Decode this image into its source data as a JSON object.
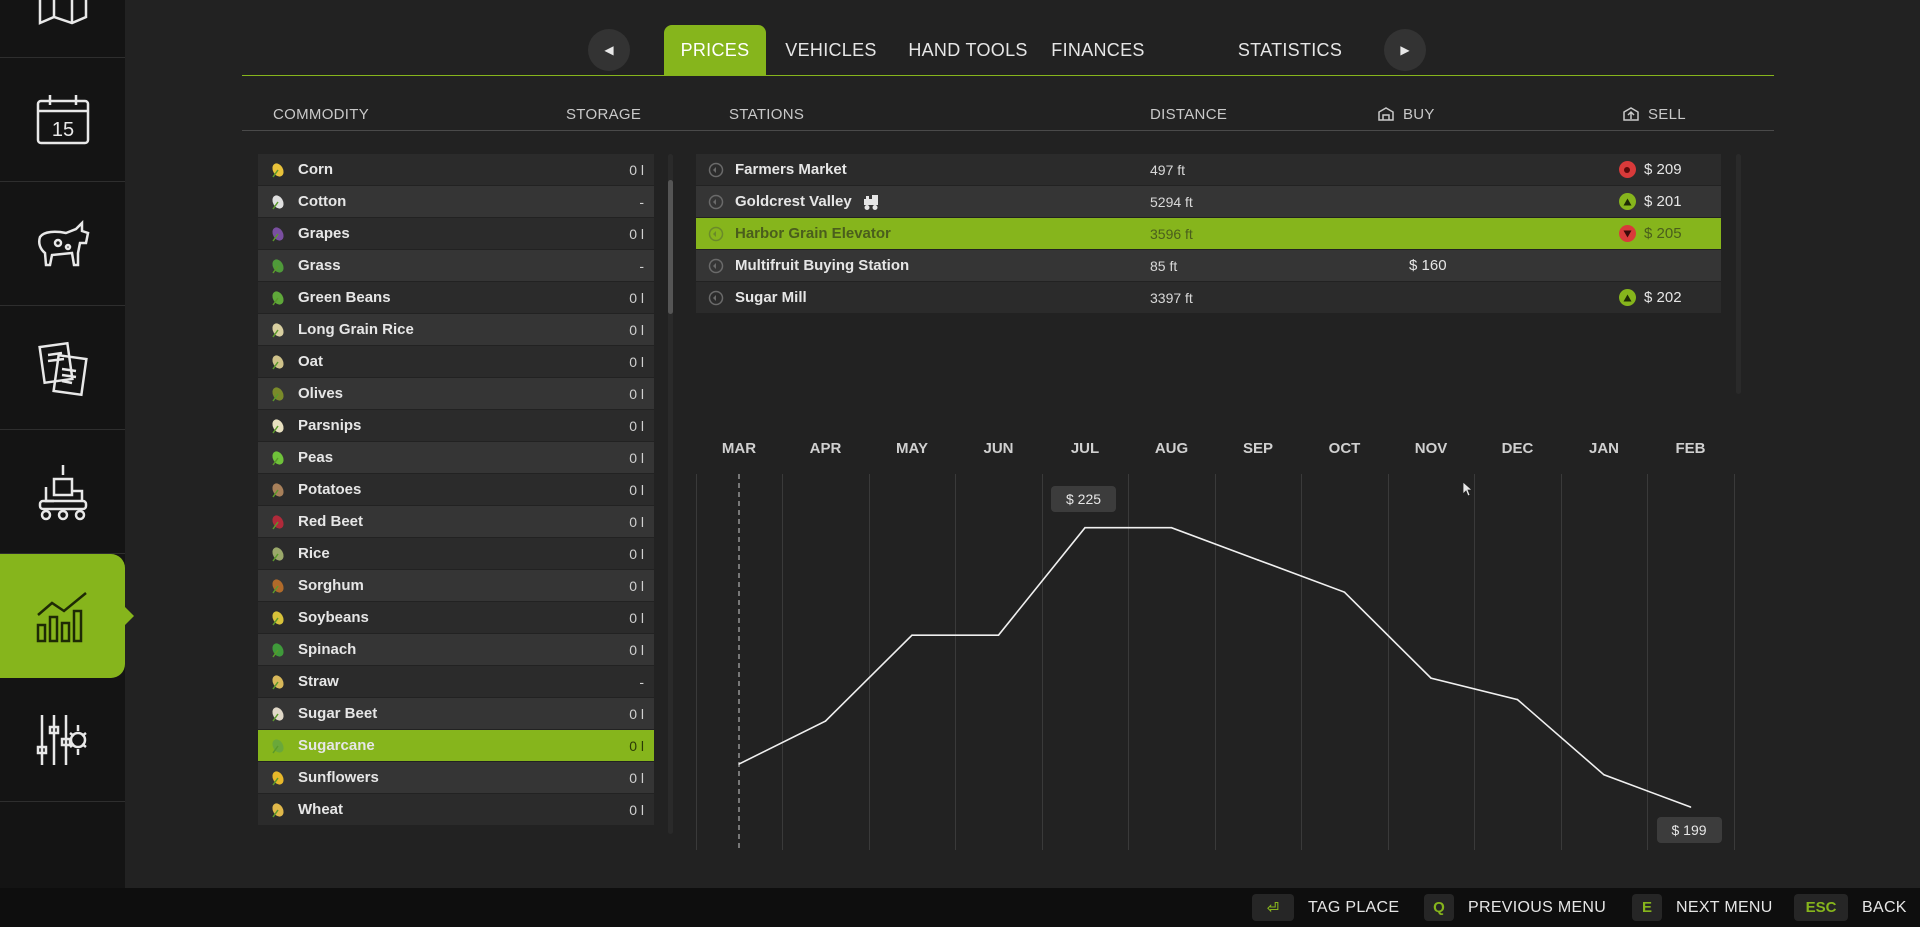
{
  "sidebar": {
    "items": [
      {
        "name": "map-icon",
        "active": false
      },
      {
        "name": "calendar-icon",
        "label": "15",
        "active": false
      },
      {
        "name": "cow-icon",
        "active": false
      },
      {
        "name": "contracts-icon",
        "active": false
      },
      {
        "name": "production-icon",
        "active": false
      },
      {
        "name": "prices-chart-icon",
        "active": true
      },
      {
        "name": "settings-icon",
        "active": false
      }
    ]
  },
  "tabs": [
    {
      "label": "PRICES",
      "active": true
    },
    {
      "label": "VEHICLES",
      "active": false
    },
    {
      "label": "HAND TOOLS",
      "active": false
    },
    {
      "label": "FINANCES",
      "active": false
    },
    {
      "label": "STATISTICS",
      "active": false
    }
  ],
  "columns": {
    "commodity": "COMMODITY",
    "storage": "STORAGE",
    "stations": "STATIONS",
    "distance": "DISTANCE",
    "buy": "BUY",
    "sell": "SELL"
  },
  "commodities": [
    {
      "name": "Corn",
      "storage": "0 l",
      "icon": "corn-icon"
    },
    {
      "name": "Cotton",
      "storage": "-",
      "icon": "cotton-icon"
    },
    {
      "name": "Grapes",
      "storage": "0 l",
      "icon": "grapes-icon"
    },
    {
      "name": "Grass",
      "storage": "-",
      "icon": "grass-icon"
    },
    {
      "name": "Green Beans",
      "storage": "0 l",
      "icon": "green-beans-icon"
    },
    {
      "name": "Long Grain Rice",
      "storage": "0 l",
      "icon": "long-grain-rice-icon"
    },
    {
      "name": "Oat",
      "storage": "0 l",
      "icon": "oat-icon"
    },
    {
      "name": "Olives",
      "storage": "0 l",
      "icon": "olives-icon"
    },
    {
      "name": "Parsnips",
      "storage": "0 l",
      "icon": "parsnips-icon"
    },
    {
      "name": "Peas",
      "storage": "0 l",
      "icon": "peas-icon"
    },
    {
      "name": "Potatoes",
      "storage": "0 l",
      "icon": "potatoes-icon"
    },
    {
      "name": "Red Beet",
      "storage": "0 l",
      "icon": "red-beet-icon"
    },
    {
      "name": "Rice",
      "storage": "0 l",
      "icon": "rice-icon"
    },
    {
      "name": "Sorghum",
      "storage": "0 l",
      "icon": "sorghum-icon"
    },
    {
      "name": "Soybeans",
      "storage": "0 l",
      "icon": "soybeans-icon"
    },
    {
      "name": "Spinach",
      "storage": "0 l",
      "icon": "spinach-icon"
    },
    {
      "name": "Straw",
      "storage": "-",
      "icon": "straw-icon"
    },
    {
      "name": "Sugar Beet",
      "storage": "0 l",
      "icon": "sugar-beet-icon"
    },
    {
      "name": "Sugarcane",
      "storage": "0 l",
      "icon": "sugarcane-icon",
      "selected": true
    },
    {
      "name": "Sunflowers",
      "storage": "0 l",
      "icon": "sunflowers-icon"
    },
    {
      "name": "Wheat",
      "storage": "0 l",
      "icon": "wheat-icon"
    }
  ],
  "stations": [
    {
      "name": "Farmers Market",
      "distance": "497 ft",
      "buy": "",
      "sell": "$ 209",
      "trend": "stop"
    },
    {
      "name": "Goldcrest Valley",
      "distance": "5294 ft",
      "buy": "",
      "sell": "$ 201",
      "trend": "up",
      "train": true
    },
    {
      "name": "Harbor Grain Elevator",
      "distance": "3596 ft",
      "buy": "",
      "sell": "$ 205",
      "trend": "down",
      "selected": true
    },
    {
      "name": "Multifruit Buying Station",
      "distance": "85 ft",
      "buy": "$ 160",
      "sell": "",
      "trend": ""
    },
    {
      "name": "Sugar Mill",
      "distance": "3397 ft",
      "buy": "",
      "sell": "$ 202",
      "trend": "up"
    }
  ],
  "chart_data": {
    "type": "line",
    "categories": [
      "MAR",
      "APR",
      "MAY",
      "JUN",
      "JUL",
      "AUG",
      "SEP",
      "OCT",
      "NOV",
      "DEC",
      "JAN",
      "FEB"
    ],
    "values": [
      203,
      207,
      215,
      215,
      225,
      225,
      222,
      219,
      211,
      209,
      202,
      199
    ],
    "ylim": [
      195,
      230
    ],
    "current_month": "MAR",
    "labels": {
      "max": "$ 225",
      "last": "$ 199"
    }
  },
  "bottom_bar": [
    {
      "key": "⏎",
      "label": "TAG PLACE"
    },
    {
      "key": "Q",
      "label": "PREVIOUS MENU"
    },
    {
      "key": "E",
      "label": "NEXT MENU"
    },
    {
      "key": "ESC",
      "label": "BACK"
    }
  ],
  "colors": {
    "accent": "#86b51c",
    "up": "#86b51c",
    "down": "#d83a3a"
  }
}
